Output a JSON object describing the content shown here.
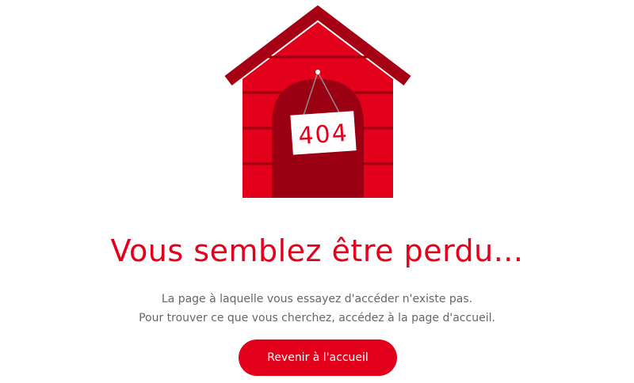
{
  "illustration": {
    "sign_text": "404",
    "colors": {
      "house": "#e2001a",
      "roof": "#a50014",
      "door": "#9b0012",
      "sign": "#ffffff"
    }
  },
  "error": {
    "title": "Vous semblez être perdu...",
    "line1": "La page à laquelle vous essayez d'accéder n'existe pas.",
    "line2": "Pour trouver ce que vous cherchez, accédez à la page d'accueil."
  },
  "actions": {
    "home_button_label": "Revenir à l'accueil"
  },
  "colors": {
    "accent": "#e2001a",
    "body_text": "#666666"
  }
}
